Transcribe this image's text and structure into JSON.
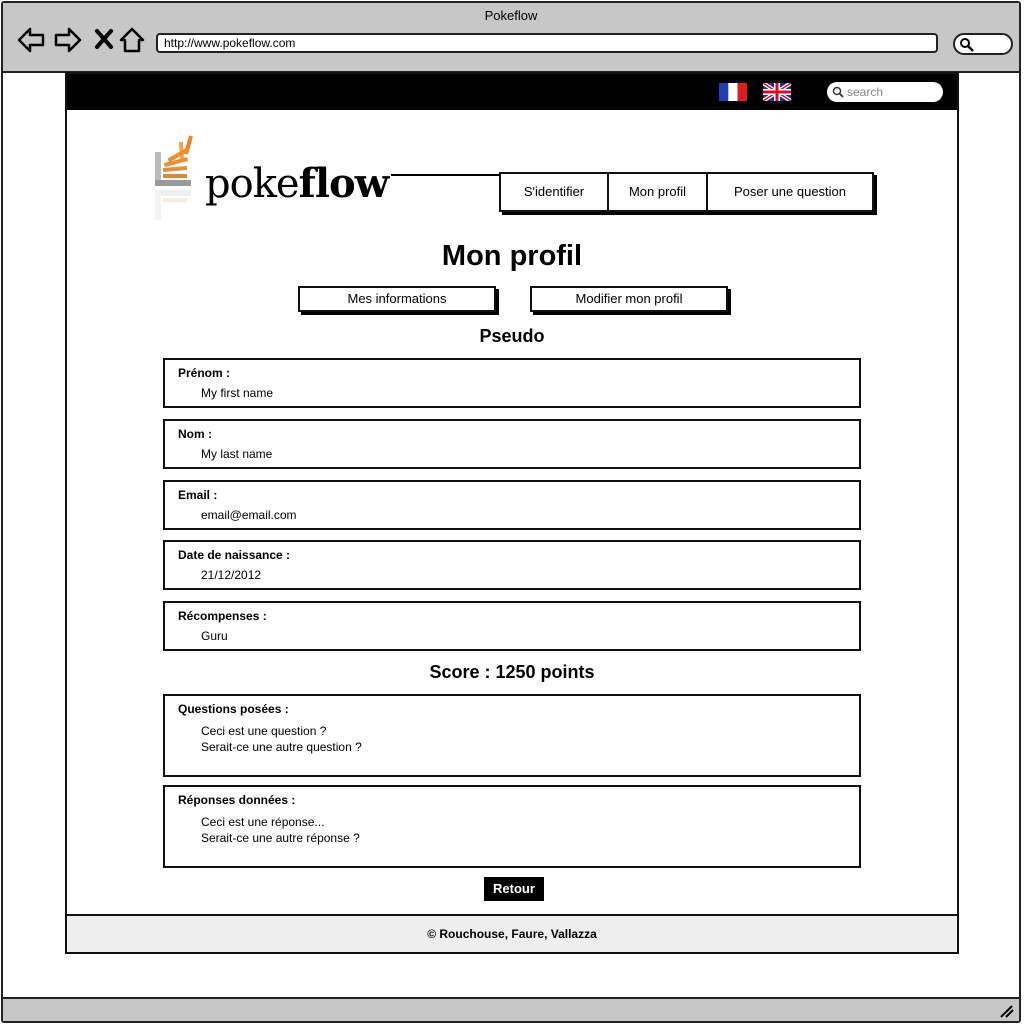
{
  "window": {
    "title": "Pokeflow"
  },
  "browser": {
    "url": "http://www.pokeflow.com"
  },
  "topbar": {
    "search_placeholder": "search",
    "languages": [
      "french-flag",
      "uk-flag"
    ]
  },
  "logo": {
    "text_light": "poke",
    "text_bold": "flow"
  },
  "menu": {
    "login": "S'identifier",
    "profile": "Mon profil",
    "ask": "Poser une question"
  },
  "page": {
    "title": "Mon profil",
    "tabs": {
      "info": "Mes informations",
      "edit": "Modifier mon profil"
    },
    "pseudo": "Pseudo",
    "fields": {
      "firstname": {
        "label": "Prénom :",
        "value": "My first name"
      },
      "lastname": {
        "label": "Nom :",
        "value": "My last name"
      },
      "email": {
        "label": "Email :",
        "value": "email@email.com"
      },
      "birthdate": {
        "label": "Date de naissance :",
        "value": "21/12/2012"
      },
      "rewards": {
        "label": "Récompenses :",
        "value": "Guru"
      }
    },
    "score": "Score : 1250 points",
    "questions": {
      "label": "Questions posées :",
      "items": [
        "Ceci est une question ?",
        "Serait-ce une autre question ?"
      ]
    },
    "answers": {
      "label": "Réponses données :",
      "items": [
        "Ceci est une réponse...",
        "Serait-ce une autre réponse ?"
      ]
    },
    "back": "Retour"
  },
  "footer": {
    "text": "© Rouchouse, Faure, Vallazza"
  },
  "colors": {
    "logo_orange": "#f48024",
    "logo_gray": "#bcbbbb",
    "chrome": "#c7c7c7"
  }
}
